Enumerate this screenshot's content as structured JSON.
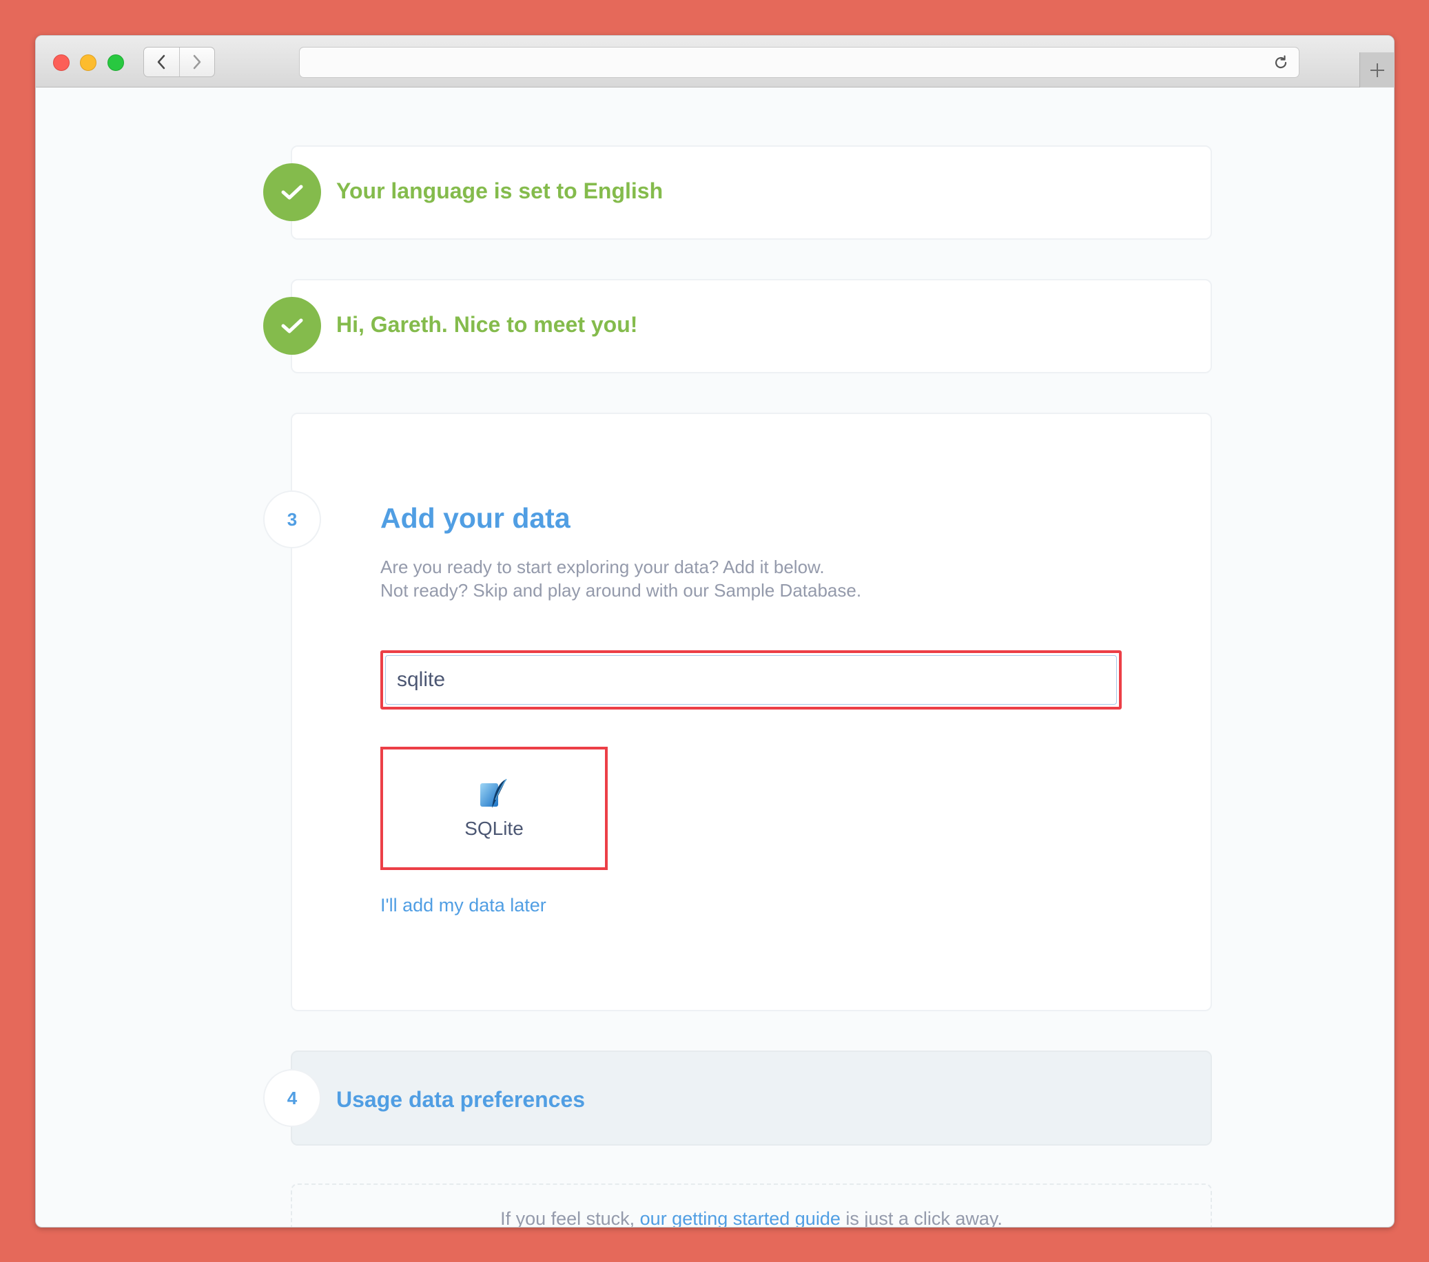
{
  "browser": {
    "back_icon": "chevron-left-icon",
    "forward_icon": "chevron-right-icon",
    "reload_icon": "reload-icon",
    "new_tab_icon": "plus-icon",
    "url": ""
  },
  "colors": {
    "background": "#e5695a",
    "success_green": "#84bb4c",
    "brand_blue": "#509ee3",
    "highlight_red": "#ec3f47",
    "muted_text": "#949aab"
  },
  "steps": {
    "language": {
      "title": "Your language is set to English",
      "icon": "checkmark-icon"
    },
    "user": {
      "title": "Hi, Gareth. Nice to meet you!",
      "icon": "checkmark-icon"
    },
    "add_data": {
      "number": "3",
      "title": "Add your data",
      "description_line1": "Are you ready to start exploring your data? Add it below.",
      "description_line2": "Not ready? Skip and play around with our Sample Database.",
      "search_value": "sqlite",
      "option_label": "SQLite",
      "option_icon": "sqlite-feather-icon",
      "skip_link": "I'll add my data later"
    },
    "usage": {
      "number": "4",
      "title": "Usage data preferences"
    }
  },
  "footer": {
    "text_before": "If you feel stuck, ",
    "link": "our getting started guide",
    "text_after": " is just a click away."
  }
}
